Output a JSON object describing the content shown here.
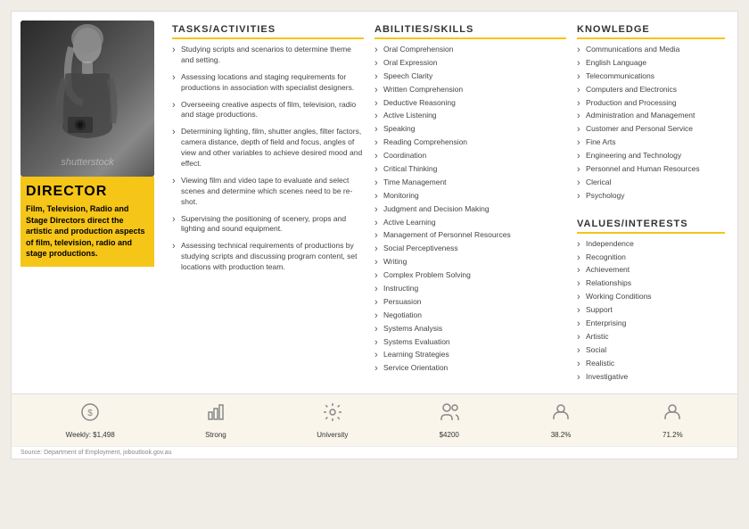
{
  "page": {
    "background": "#f0ede6",
    "source": "Source: Department of Employment, joboutlook.gov.au"
  },
  "director": {
    "role": "DIRECTOR",
    "subtitle": "Film, Television, Radio and Stage Directors direct the artistic and production aspects of film, television, radio and stage productions.",
    "image_alt": "Director photo"
  },
  "tasks": {
    "header": "TASKS/ACTIVITIES",
    "items": [
      "Studying scripts and scenarios to determine theme and setting.",
      "Assessing locations and staging requirements for productions in association with specialist designers.",
      "Overseeing creative aspects of film, television, radio and stage productions.",
      "Determining lighting, film, shutter angles, filter factors, camera distance, depth of field and focus, angles of view and other variables to achieve desired mood and effect.",
      "Viewing film and video tape to evaluate and select scenes and determine which scenes need to be re-shot.",
      "Supervising the positioning of scenery, props and lighting and sound equipment.",
      "Assessing technical requirements of productions by studying scripts and discussing program content, set locations with production team."
    ]
  },
  "abilities": {
    "header": "ABILITIES/SKILLS",
    "items": [
      "Oral Comprehension",
      "Oral Expression",
      "Speech Clarity",
      "Written Comprehension",
      "Deductive Reasoning",
      "Active Listening",
      "Speaking",
      "Reading Comprehension",
      "Coordination",
      "Critical Thinking",
      "Time Management",
      "Monitoring",
      "Judgment and Decision Making",
      "Active Learning",
      "Management of Personnel Resources",
      "Social Perceptiveness",
      "Writing",
      "Complex Problem Solving",
      "Instructing",
      "Persuasion",
      "Negotiation",
      "Systems Analysis",
      "Systems Evaluation",
      "Learning Strategies",
      "Service Orientation"
    ]
  },
  "knowledge": {
    "header": "KNOWLEDGE",
    "items": [
      "Communications and Media",
      "English Language",
      "Telecommunications",
      "Computers and Electronics",
      "Production and Processing",
      "Administration and Management",
      "Customer and Personal Service",
      "Fine Arts",
      "Engineering and Technology",
      "Personnel and Human Resources",
      "Clerical",
      "Psychology"
    ]
  },
  "values": {
    "header": "VALUES/INTERESTS",
    "items": [
      "Independence",
      "Recognition",
      "Achievement",
      "Relationships",
      "Working Conditions",
      "Support",
      "Enterprising",
      "Artistic",
      "Social",
      "Realistic",
      "Investigative"
    ]
  },
  "stats": [
    {
      "icon": "💰",
      "value": "Weekly: $1,498",
      "label": ""
    },
    {
      "icon": "📊",
      "value": "Strong",
      "label": ""
    },
    {
      "icon": "⚙️",
      "value": "University",
      "label": ""
    },
    {
      "icon": "👥",
      "value": "$4200",
      "label": ""
    },
    {
      "icon": "👤",
      "value": "38.2%",
      "label": ""
    },
    {
      "icon": "👤",
      "value": "71.2%",
      "label": ""
    }
  ]
}
